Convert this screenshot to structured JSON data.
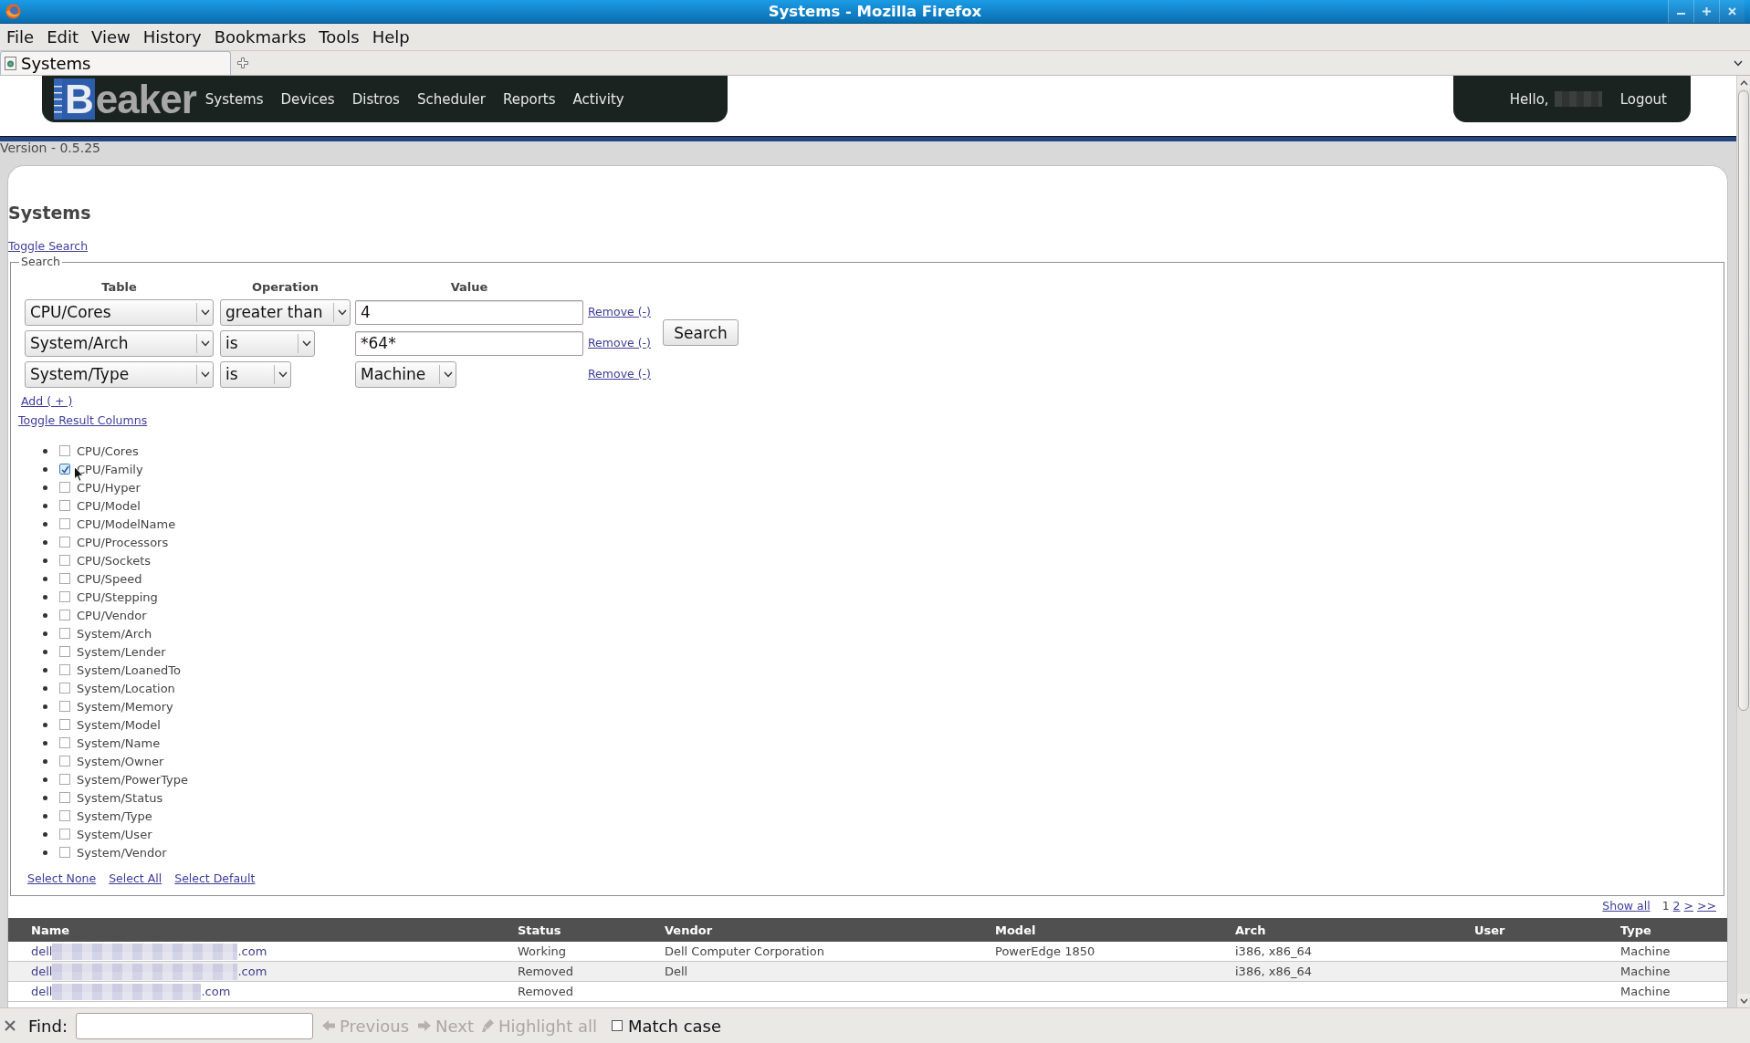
{
  "window": {
    "title": "Systems - Mozilla Firefox"
  },
  "menu": [
    "File",
    "Edit",
    "View",
    "History",
    "Bookmarks",
    "Tools",
    "Help"
  ],
  "tabs": [
    {
      "label": "Systems",
      "selected": true
    }
  ],
  "header": {
    "logo": "Beaker",
    "nav": [
      "Systems",
      "Devices",
      "Distros",
      "Scheduler",
      "Reports",
      "Activity"
    ],
    "greeting": "Hello,",
    "logout": "Logout"
  },
  "version": "Version - 0.5.25",
  "page_title": "Systems",
  "toggle_search": "Toggle Search",
  "search": {
    "legend": "Search",
    "columns": [
      "Table",
      "Operation",
      "Value"
    ],
    "rows": [
      {
        "table": "CPU/Cores",
        "operation": "greater than",
        "kind": "text",
        "value": "4",
        "remove": "Remove (-)"
      },
      {
        "table": "System/Arch",
        "operation": "is",
        "kind": "text",
        "value": "*64*",
        "remove": "Remove (-)"
      },
      {
        "table": "System/Type",
        "operation": "is",
        "kind": "select",
        "value": "Machine",
        "remove": "Remove (-)"
      }
    ],
    "button": "Search",
    "add": "Add ( + )"
  },
  "toggle_result_columns": "Toggle Result Columns",
  "result_columns": [
    {
      "label": "CPU/Cores",
      "checked": false
    },
    {
      "label": "CPU/Family",
      "checked": true
    },
    {
      "label": "CPU/Hyper",
      "checked": false
    },
    {
      "label": "CPU/Model",
      "checked": false
    },
    {
      "label": "CPU/ModelName",
      "checked": false
    },
    {
      "label": "CPU/Processors",
      "checked": false
    },
    {
      "label": "CPU/Sockets",
      "checked": false
    },
    {
      "label": "CPU/Speed",
      "checked": false
    },
    {
      "label": "CPU/Stepping",
      "checked": false
    },
    {
      "label": "CPU/Vendor",
      "checked": false
    },
    {
      "label": "System/Arch",
      "checked": false
    },
    {
      "label": "System/Lender",
      "checked": false
    },
    {
      "label": "System/LoanedTo",
      "checked": false
    },
    {
      "label": "System/Location",
      "checked": false
    },
    {
      "label": "System/Memory",
      "checked": false
    },
    {
      "label": "System/Model",
      "checked": false
    },
    {
      "label": "System/Name",
      "checked": false
    },
    {
      "label": "System/Owner",
      "checked": false
    },
    {
      "label": "System/PowerType",
      "checked": false
    },
    {
      "label": "System/Status",
      "checked": false
    },
    {
      "label": "System/Type",
      "checked": false
    },
    {
      "label": "System/User",
      "checked": false
    },
    {
      "label": "System/Vendor",
      "checked": false
    }
  ],
  "selection_links": [
    "Select None",
    "Select All",
    "Select Default"
  ],
  "pagination": {
    "show_all": "Show all",
    "pages": [
      {
        "label": "1",
        "selected": true
      },
      {
        "label": "2",
        "selected": false
      }
    ],
    "next": ">",
    "last": ">>"
  },
  "table": {
    "columns": [
      "Name",
      "Status",
      "Vendor",
      "Model",
      "Arch",
      "User",
      "Type"
    ],
    "rows": [
      {
        "name_prefix": "dell",
        "name_suffix": ".com",
        "status": "Working",
        "vendor": "Dell Computer Corporation",
        "model": "PowerEdge 1850",
        "arch": "i386, x86_64",
        "type": "Machine"
      },
      {
        "name_prefix": "dell",
        "name_suffix": ".com",
        "status": "Removed",
        "vendor": "Dell",
        "arch": "i386, x86_64",
        "type": "Machine"
      },
      {
        "name_prefix": "dell",
        "name_suffix": ".com",
        "status": "Removed",
        "type": "Machine"
      }
    ]
  },
  "find_bar": {
    "label": "Find:",
    "buttons": [
      {
        "kind": "previous",
        "label": "Previous",
        "disabled": true
      },
      {
        "kind": "next",
        "label": "Next",
        "disabled": true
      },
      {
        "kind": "highlight",
        "label": "Highlight all",
        "disabled": true
      }
    ],
    "match_case": {
      "label": "Match case",
      "checked": false
    }
  }
}
